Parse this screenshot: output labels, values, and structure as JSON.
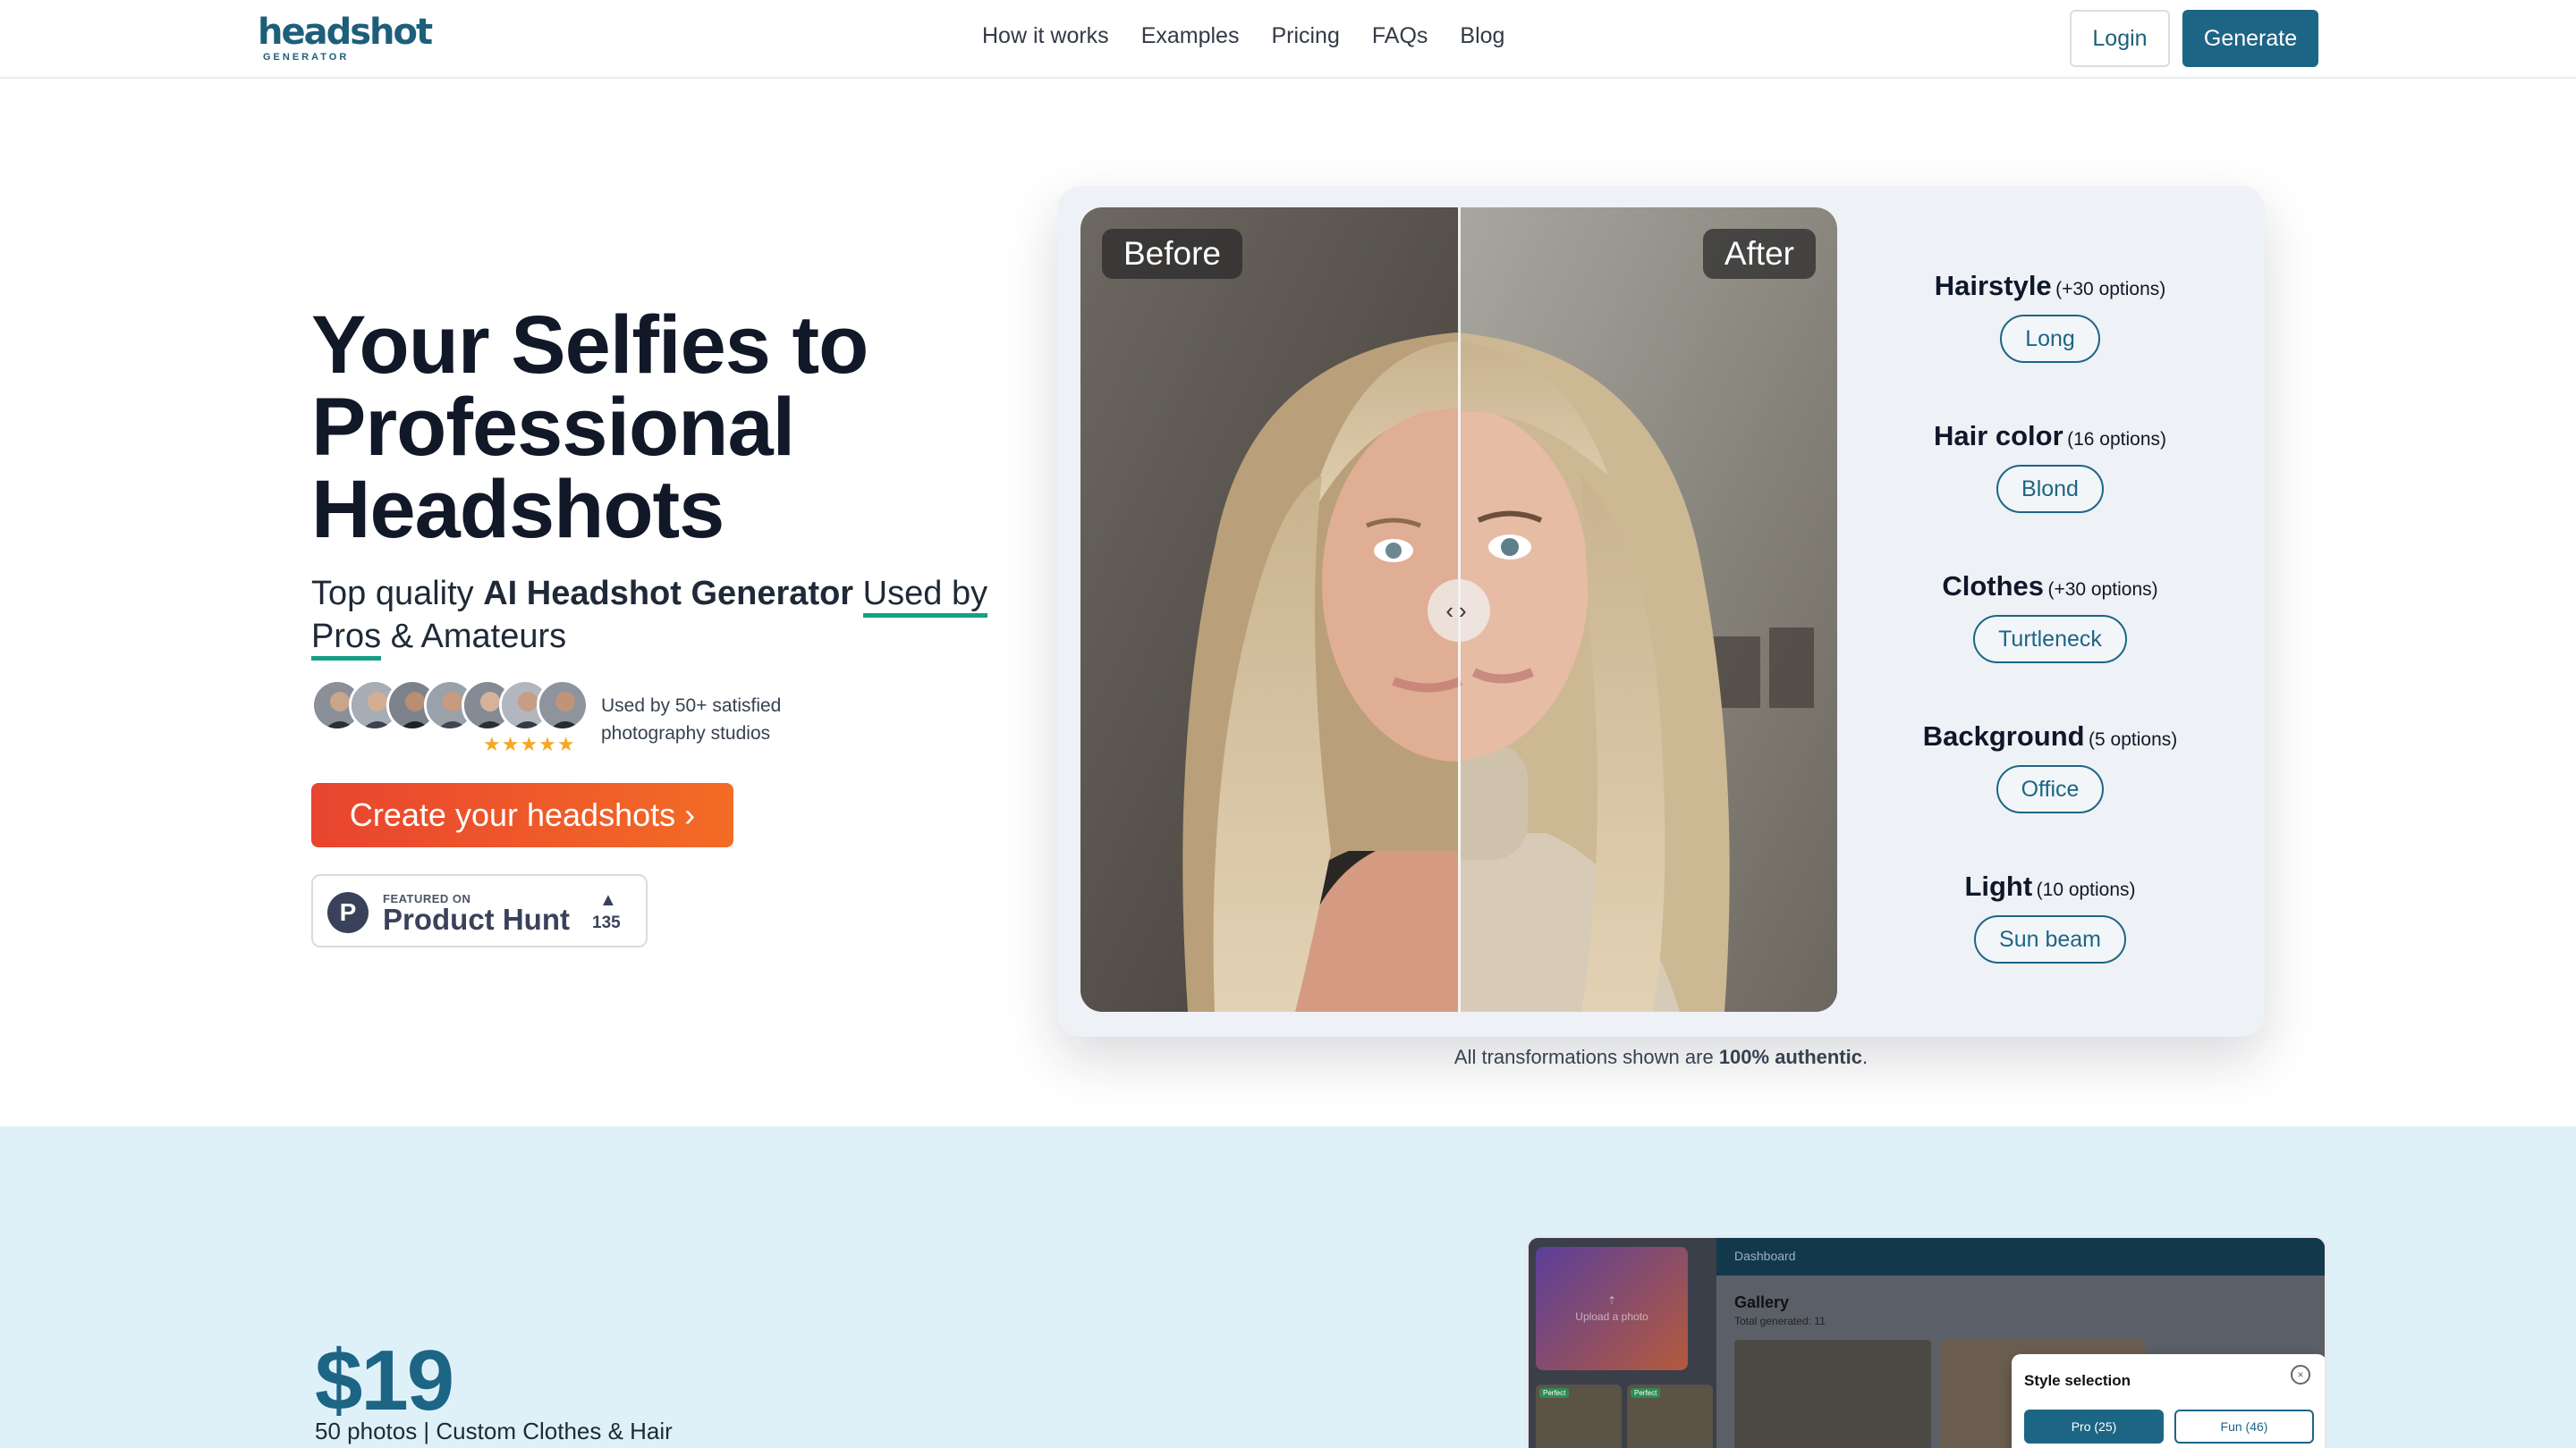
{
  "brand": {
    "name": "headshot",
    "sub": "GENERATOR",
    "accent": "#1d6585"
  },
  "nav": {
    "links": [
      "How it works",
      "Examples",
      "Pricing",
      "FAQs",
      "Blog"
    ],
    "login": "Login",
    "generate": "Generate"
  },
  "hero": {
    "title": "Your Selfies to Professional Headshots",
    "sub_plain1": "Top quality",
    "sub_bold": "AI Headshot Generator",
    "sub_underline1": "Used by",
    "sub_underline2": "Pros",
    "sub_plain2": "& Amateurs",
    "stars": "★★★★★",
    "social_proof": "Used by 50+ satisfied photography studios",
    "cta": "Create your headshots",
    "cta_chevron": "›",
    "product_hunt": {
      "featured": "FEATURED ON",
      "name": "Product Hunt",
      "logo_letter": "P",
      "arrow": "▲",
      "count": "135"
    }
  },
  "comparison": {
    "before": "Before",
    "after": "After",
    "knob": "‹›",
    "options": [
      {
        "title": "Hairstyle",
        "count": "(+30 options)",
        "value": "Long"
      },
      {
        "title": "Hair color",
        "count": "(16 options)",
        "value": "Blond"
      },
      {
        "title": "Clothes",
        "count": "(+30 options)",
        "value": "Turtleneck"
      },
      {
        "title": "Background",
        "count": "(5 options)",
        "value": "Office"
      },
      {
        "title": "Light",
        "count": "(10 options)",
        "value": "Sun beam"
      }
    ],
    "authentic_pre": "All transformations shown are",
    "authentic_bold": "100% authentic",
    "authentic_post": "."
  },
  "pricing": {
    "price": "$19",
    "details": "50 photos | Custom Clothes & Hair"
  },
  "dashboard": {
    "upload": "Upload a photo",
    "upload_icon": "⇡",
    "thumb_tag": "Perfect",
    "top": "Dashboard",
    "gallery_title": "Gallery",
    "gallery_sub": "Total generated: 11",
    "style_title": "Style selection",
    "style_close": "×",
    "style_pro": "Pro (25)",
    "style_fun": "Fun (46)"
  }
}
